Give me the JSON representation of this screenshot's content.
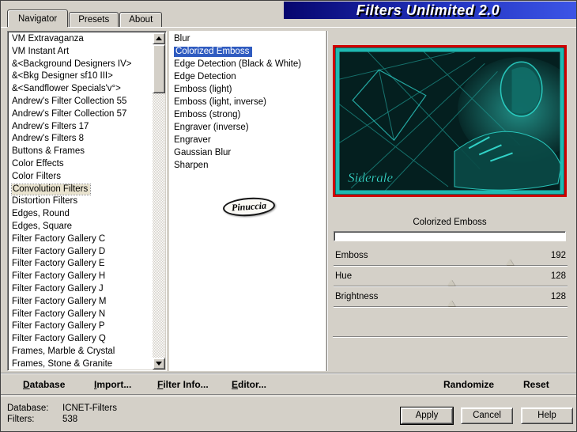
{
  "window": {
    "title": "Filters Unlimited 2.0"
  },
  "tabs": {
    "navigator": "Navigator",
    "presets": "Presets",
    "about": "About"
  },
  "navigator": {
    "categories": [
      "VM Extravaganza",
      "VM Instant Art",
      "&<Background Designers IV>",
      "&<Bkg Designer sf10 III>",
      "&<Sandflower Specials'v°>",
      "Andrew's Filter Collection 55",
      "Andrew's Filter Collection 57",
      "Andrew's Filters 17",
      "Andrew's Filters 8",
      "Buttons & Frames",
      "Color Effects",
      "Color Filters",
      "Convolution Filters",
      "Distortion Filters",
      "Edges, Round",
      "Edges, Square",
      "Filter Factory Gallery C",
      "Filter Factory Gallery D",
      "Filter Factory Gallery E",
      "Filter Factory Gallery H",
      "Filter Factory Gallery J",
      "Filter Factory Gallery M",
      "Filter Factory Gallery N",
      "Filter Factory Gallery P",
      "Filter Factory Gallery Q",
      "Frames, Marble & Crystal",
      "Frames, Stone & Granite"
    ],
    "selected_category": "Convolution Filters",
    "filters": [
      "Blur",
      "Colorized Emboss",
      "Edge Detection (Black & White)",
      "Edge Detection",
      "Emboss (light)",
      "Emboss (light, inverse)",
      "Emboss (strong)",
      "Engraver (inverse)",
      "Engraver",
      "Gaussian Blur",
      "Sharpen"
    ],
    "selected_filter": "Colorized Emboss"
  },
  "watermark": "Pinuccia",
  "preview": {
    "caption": "Siderale",
    "filter_name": "Colorized Emboss"
  },
  "sliders": {
    "max": 255,
    "items": [
      {
        "label": "Emboss",
        "value": 192
      },
      {
        "label": "Hue",
        "value": 128
      },
      {
        "label": "Brightness",
        "value": 128
      }
    ]
  },
  "command_bar": {
    "database": "Database",
    "import": "Import...",
    "filter_info": "Filter Info...",
    "editor": "Editor...",
    "randomize": "Randomize",
    "reset": "Reset"
  },
  "status": {
    "database_label": "Database:",
    "database_value": "ICNET-Filters",
    "filters_label": "Filters:",
    "filters_value": "538"
  },
  "dialog_buttons": {
    "apply": "Apply",
    "cancel": "Cancel",
    "help": "Help"
  },
  "colors": {
    "title_gradient_start": "#06066e",
    "title_gradient_end": "#3c55e6",
    "selection_blue": "#2f5bc0",
    "category_highlight": "#e9e3cf",
    "preview_border_red": "#cf0000",
    "preview_teal": "#2fe0d4",
    "dialog_gray": "#d4d0c8"
  }
}
